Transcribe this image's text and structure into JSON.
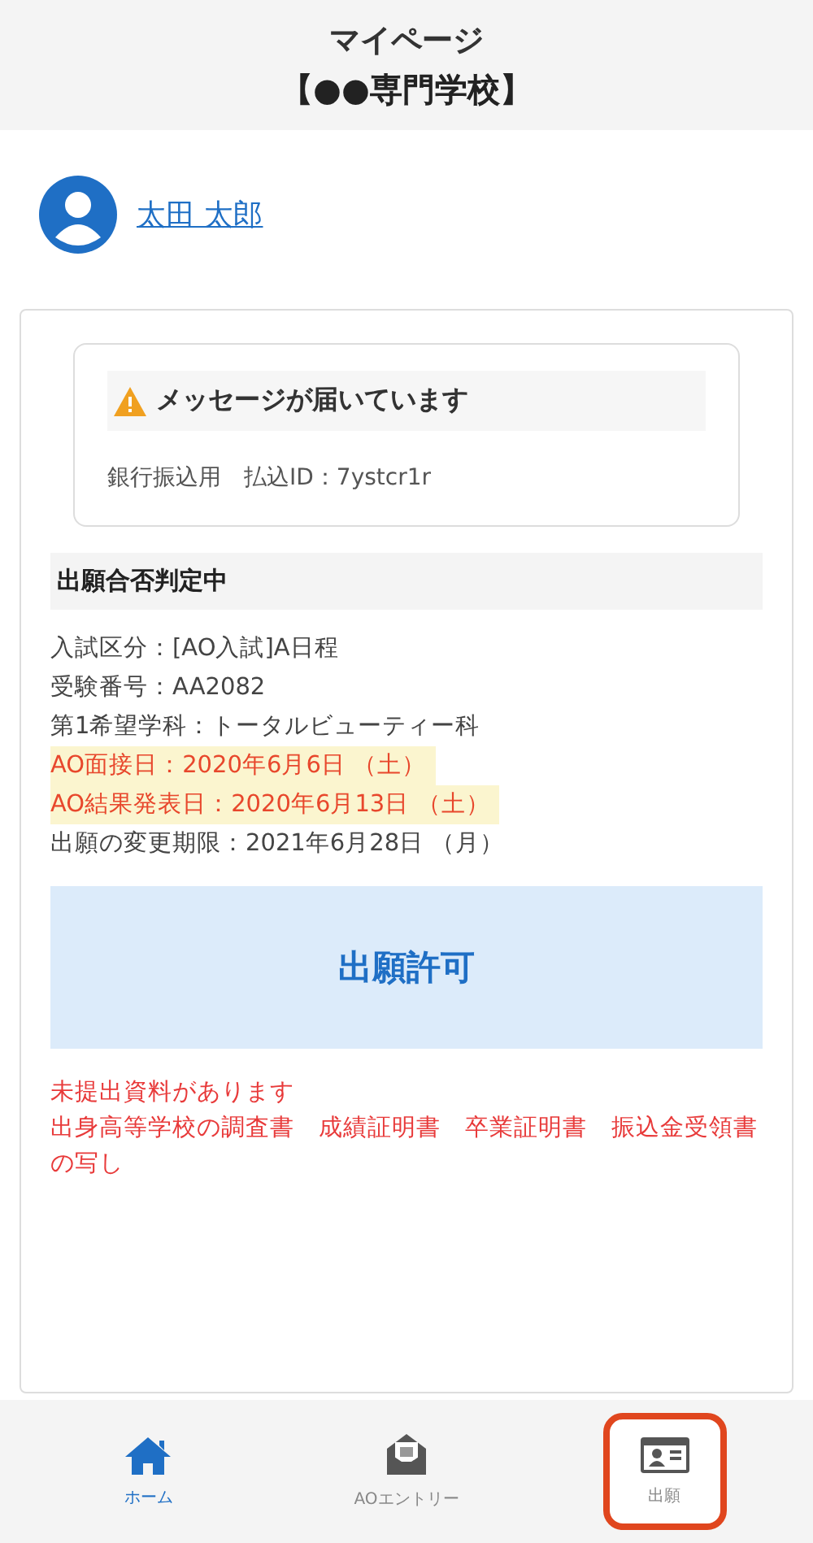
{
  "header": {
    "title": "マイページ",
    "subtitle": "【●●専門学校】"
  },
  "user": {
    "name": "太田 太郎"
  },
  "message_card": {
    "title": "メッセージが届いています",
    "body": "銀行振込用　払込ID：7ystcr1r"
  },
  "status": {
    "heading": "出願合否判定中",
    "details": [
      {
        "text": "入試区分：[AO入試]A日程",
        "highlight": false
      },
      {
        "text": "受験番号：AA2082",
        "highlight": false
      },
      {
        "text": "第1希望学科：トータルビューティー科",
        "highlight": false
      },
      {
        "text": "AO面接日：2020年6月6日 （土）",
        "highlight": true
      },
      {
        "text": "AO結果発表日：2020年6月13日 （土）",
        "highlight": true
      },
      {
        "text": "出願の変更期限：2021年6月28日 （月）",
        "highlight": false
      }
    ],
    "result": "出願許可",
    "notice_title": "未提出資料があります",
    "notice_body": "出身高等学校の調査書　成績証明書　卒業証明書　振込金受領書の写し"
  },
  "bottom_nav": [
    {
      "label": "ホーム",
      "kind": "home",
      "selected": true,
      "highlighted": false
    },
    {
      "label": "AOエントリー",
      "kind": "entry",
      "selected": false,
      "highlighted": false
    },
    {
      "label": "出願",
      "kind": "application",
      "selected": false,
      "highlighted": true
    }
  ]
}
